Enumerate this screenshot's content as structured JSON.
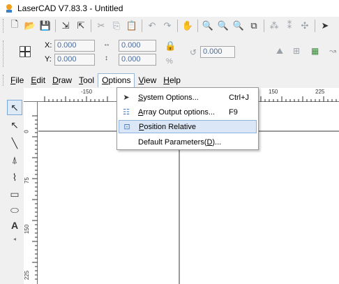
{
  "window": {
    "title": "LaserCAD V7.83.3 - Untitled"
  },
  "coords": {
    "x_label": "X:",
    "x_value": "0.000",
    "y_label": "Y:",
    "y_value": "0.000",
    "w_value": "0.000",
    "h_value": "0.000",
    "percent_label": "%",
    "rotate_value": "0.000"
  },
  "menubar": {
    "file": {
      "pre": "",
      "u": "F",
      "post": "ile"
    },
    "edit": {
      "pre": "",
      "u": "E",
      "post": "dit"
    },
    "draw": {
      "pre": "",
      "u": "D",
      "post": "raw"
    },
    "tool": {
      "pre": "",
      "u": "T",
      "post": "ool"
    },
    "options": {
      "pre": "",
      "u": "O",
      "post": "ptions"
    },
    "view": {
      "pre": "",
      "u": "V",
      "post": "iew"
    },
    "help": {
      "pre": "",
      "u": "H",
      "post": "elp"
    }
  },
  "options_menu": {
    "system": {
      "pre": "",
      "u": "S",
      "post": "ystem Options...",
      "shortcut": "Ctrl+J"
    },
    "array": {
      "pre": "",
      "u": "A",
      "post": "rray Output options...",
      "shortcut": "F9"
    },
    "position": {
      "pre": "",
      "u": "P",
      "post": "osition Relative",
      "shortcut": ""
    },
    "defaults": {
      "pre": "Default Parameters(",
      "u": "D",
      "post": ")...",
      "shortcut": ""
    }
  },
  "ruler": {
    "top_labels": [
      "-150",
      "150",
      "225"
    ],
    "left_labels": [
      "0",
      "75",
      "150",
      "225"
    ]
  },
  "icons": {
    "app": "laser-app-icon",
    "select_tool": "pointer-icon"
  },
  "colors": {
    "highlight": "#dbe7f6",
    "highlight_border": "#8fb3e0",
    "field_text": "#4a6b9a"
  }
}
